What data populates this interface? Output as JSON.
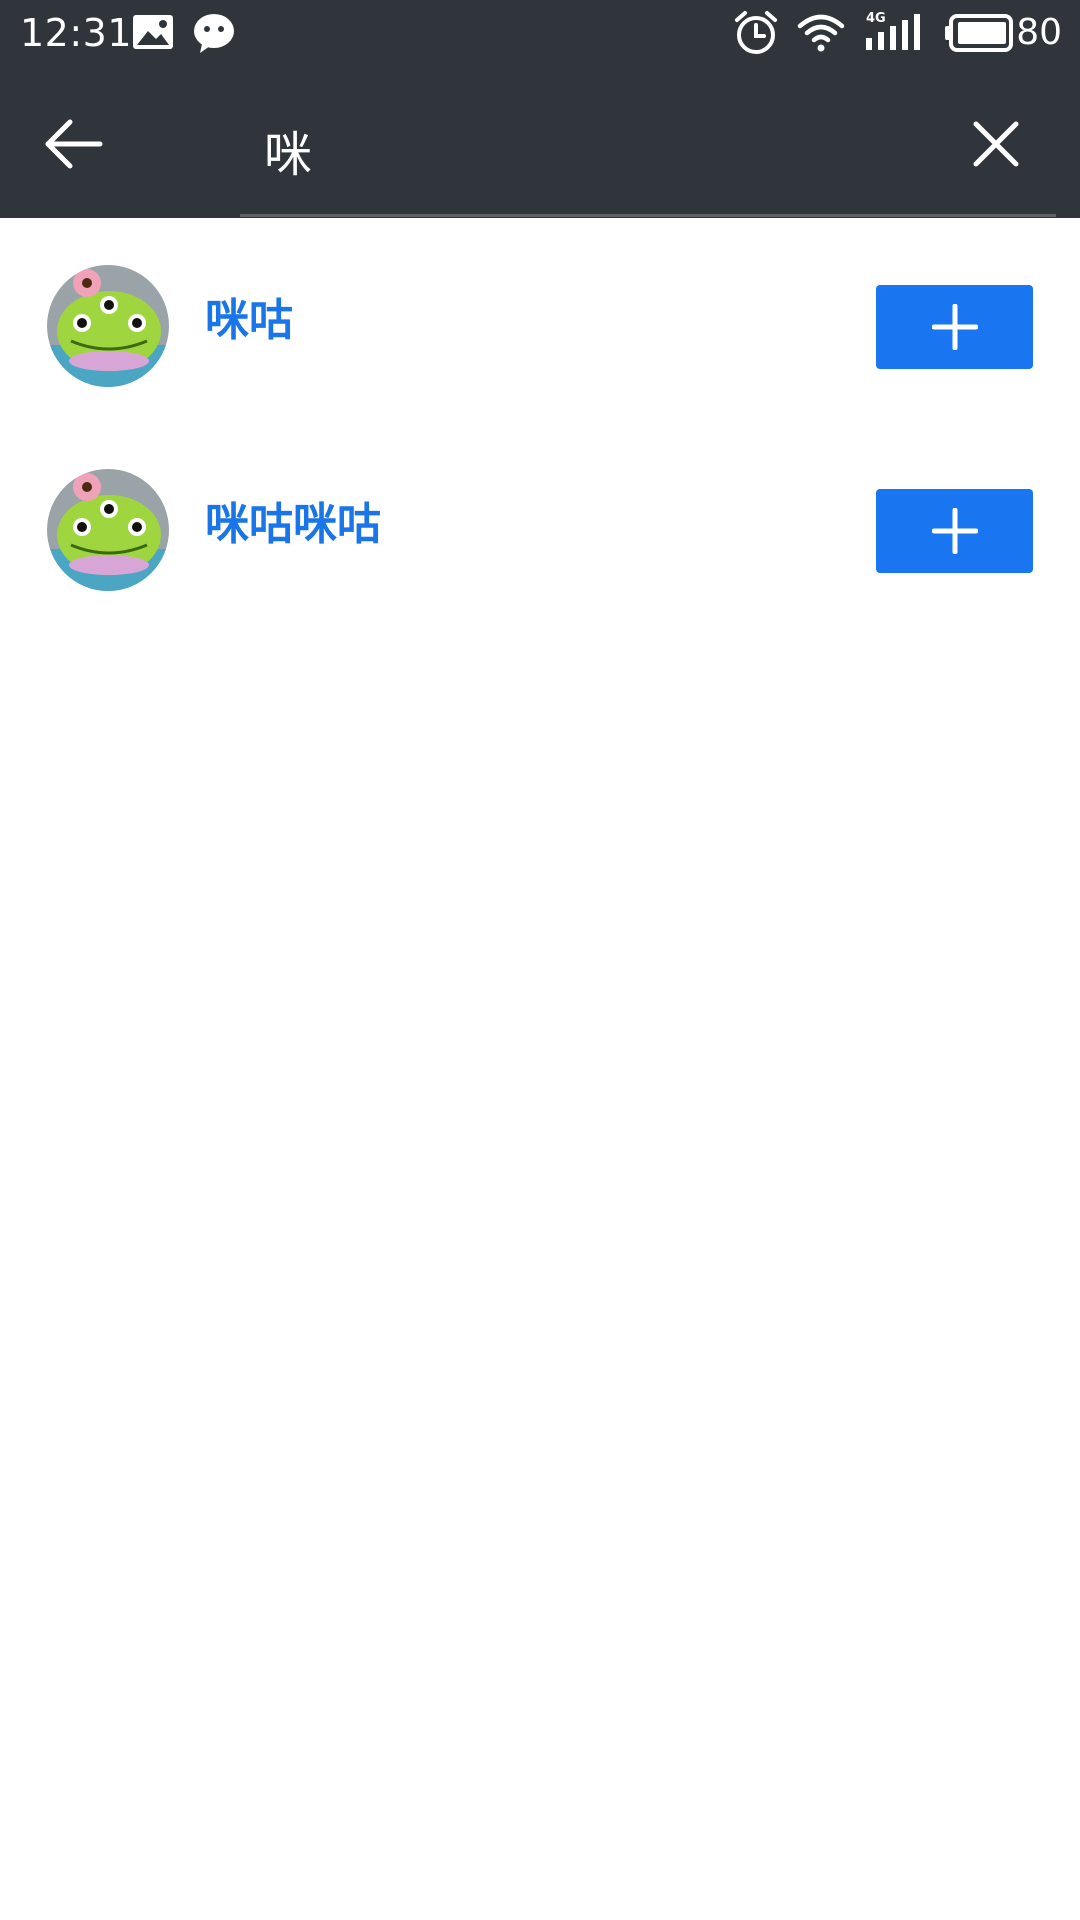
{
  "status_bar": {
    "time": "12:31",
    "battery_level": "80",
    "network_label": "4G",
    "icons": [
      "image-notification-icon",
      "wechat-icon",
      "alarm-icon",
      "wifi-icon",
      "signal-icon",
      "battery-icon"
    ]
  },
  "search": {
    "query": "咪",
    "back_icon": "arrow-left-icon",
    "clear_icon": "close-icon"
  },
  "results": [
    {
      "name": "咪咕",
      "avatar": "alien-plush-avatar",
      "action_icon": "plus-icon"
    },
    {
      "name": "咪咕咪咕",
      "avatar": "alien-plush-avatar",
      "action_icon": "plus-icon"
    }
  ],
  "colors": {
    "header_bg": "#30353b",
    "accent": "#1a76f0",
    "name_text": "#1a76e8",
    "page_bg": "#ffffff"
  }
}
